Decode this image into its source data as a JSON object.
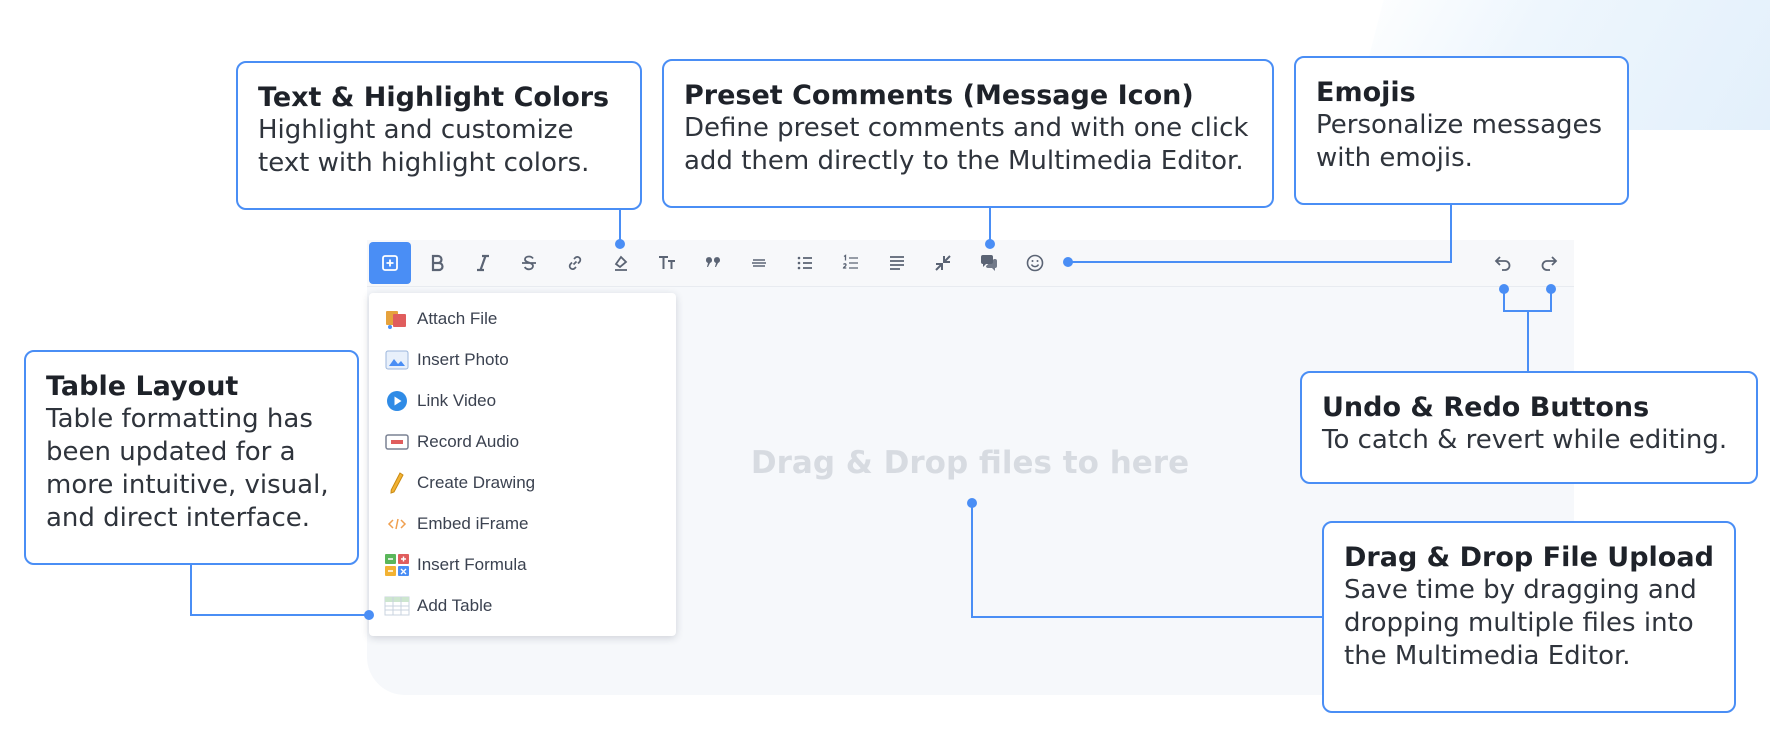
{
  "toolbar": {
    "buttons": [
      {
        "icon": "plus-square-icon"
      },
      {
        "icon": "bold-icon"
      },
      {
        "icon": "italic-icon"
      },
      {
        "icon": "strikethrough-icon"
      },
      {
        "icon": "link-icon"
      },
      {
        "icon": "highlight-color-icon"
      },
      {
        "icon": "font-size-icon"
      },
      {
        "icon": "quote-icon"
      },
      {
        "icon": "horizontal-rule-icon"
      },
      {
        "icon": "bullet-list-icon"
      },
      {
        "icon": "numbered-list-icon"
      },
      {
        "icon": "align-icon"
      },
      {
        "icon": "collapse-arrows-icon"
      },
      {
        "icon": "preset-comments-icon"
      },
      {
        "icon": "emoji-icon"
      },
      {
        "icon": "undo-icon"
      },
      {
        "icon": "redo-icon"
      }
    ]
  },
  "insert_menu": {
    "items": [
      {
        "label": "Attach File",
        "icon": "attach-file-icon"
      },
      {
        "label": "Insert Photo",
        "icon": "insert-photo-icon"
      },
      {
        "label": "Link Video",
        "icon": "link-video-icon"
      },
      {
        "label": "Record Audio",
        "icon": "record-audio-icon"
      },
      {
        "label": "Create Drawing",
        "icon": "pencil-icon"
      },
      {
        "label": "Embed iFrame",
        "icon": "code-icon"
      },
      {
        "label": "Insert Formula",
        "icon": "formula-icon"
      },
      {
        "label": "Add Table",
        "icon": "table-icon"
      }
    ]
  },
  "editor": {
    "dropzone_text": "Drag & Drop files to here"
  },
  "callouts": {
    "text_colors": {
      "title": "Text & Highlight Colors",
      "body": [
        "Highlight and customize",
        "text with highlight colors."
      ]
    },
    "preset_comments": {
      "title": "Preset Comments (Message Icon)",
      "body": [
        "Define preset comments and with one click",
        "add them directly to the Multimedia Editor."
      ]
    },
    "emojis": {
      "title": "Emojis",
      "body": [
        "Personalize messages",
        "with emojis."
      ]
    },
    "table_layout": {
      "title": "Table Layout",
      "body": [
        "Table formatting has",
        "been updated for a",
        "more intuitive, visual,",
        "and direct interface."
      ]
    },
    "undo_redo": {
      "title": "Undo & Redo Buttons",
      "body": [
        "To catch & revert while editing."
      ]
    },
    "drag_drop": {
      "title": "Drag & Drop File Upload",
      "body": [
        "Save time by dragging and",
        "dropping multiple files into",
        "the Multimedia Editor."
      ]
    }
  },
  "colors": {
    "accent": "#4a8ef5",
    "toolbar_bg": "#f7f8fa",
    "editor_bg": "#f6f8fb",
    "dropzone_text": "#d7dbe1"
  }
}
